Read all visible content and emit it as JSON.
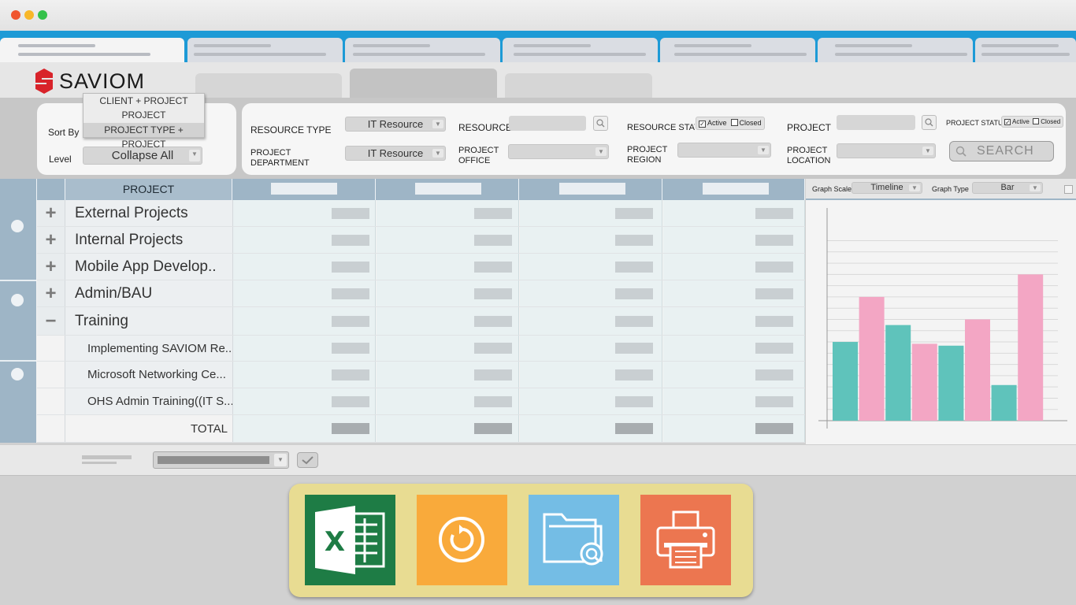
{
  "window": {
    "controls": {
      "close_color": "#f0552f",
      "minimize_color": "#f8b729",
      "maximize_color": "#35c14a"
    }
  },
  "app": {
    "logo_text": "SAVIOM",
    "logo_color": "#d8232a"
  },
  "sort": {
    "label": "Sort By",
    "options": [
      "CLIENT + PROJECT",
      "PROJECT",
      "PROJECT TYPE + PROJECT"
    ],
    "highlighted": "PROJECT TYPE + PROJECT"
  },
  "level": {
    "label": "Level",
    "value": "Collapse All"
  },
  "filters": {
    "resource_type": {
      "label": "RESOURCE TYPE",
      "value": "IT Resource"
    },
    "project_department": {
      "label_line1": "PROJECT",
      "label_line2": "DEPARTMENT",
      "value": "IT Resource"
    },
    "resource": {
      "label": "RESOURCE"
    },
    "project_office": {
      "label_line1": "PROJECT",
      "label_line2": "OFFICE"
    },
    "resource_status": {
      "label": "RESOURCE STATUS",
      "active": "Active",
      "closed": "Closed",
      "active_checked": true,
      "closed_checked": false
    },
    "project_region": {
      "label_line1": "PROJECT",
      "label_line2": "REGION"
    },
    "project": {
      "label": "PROJECT"
    },
    "project_location": {
      "label_line1": "PROJECT",
      "label_line2": "LOCATION"
    },
    "project_status": {
      "label": "PROJECT STATUS",
      "active": "Active",
      "closed": "Closed",
      "active_checked": true,
      "closed_checked": false
    },
    "search_button": "SEARCH"
  },
  "grid": {
    "header": "PROJECT",
    "rows": [
      {
        "name": "External Projects",
        "toggle": "+",
        "kind": "group"
      },
      {
        "name": "Internal Projects",
        "toggle": "+",
        "kind": "group"
      },
      {
        "name": "Mobile App Develop..",
        "toggle": "+",
        "kind": "group"
      },
      {
        "name": "Admin/BAU",
        "toggle": "+",
        "kind": "group"
      },
      {
        "name": "Training",
        "toggle": "−",
        "kind": "group"
      },
      {
        "name": "Implementing SAVIOM Re...",
        "kind": "child"
      },
      {
        "name": "Microsoft Networking  Ce...",
        "kind": "child"
      },
      {
        "name": "OHS Admin Training((IT S....",
        "kind": "child"
      }
    ],
    "total_label": "TOTAL"
  },
  "graph": {
    "scale_label": "Graph Scale",
    "scale_value": "Timeline",
    "type_label": "Graph Type",
    "type_value": "Bar"
  },
  "chart_data": {
    "type": "bar",
    "colors": {
      "teal": "#5fc3bb",
      "pink": "#f3a6c4"
    },
    "ylim": [
      0,
      10
    ],
    "grid": true,
    "series": [
      {
        "values": [
          4.2,
          5.1,
          4.0,
          1.9
        ],
        "color": "teal"
      },
      {
        "values": [
          6.6,
          4.1,
          5.4,
          7.8
        ],
        "color": "pink"
      }
    ],
    "order": [
      "teal",
      "pink",
      "teal",
      "pink",
      "teal",
      "pink",
      "teal",
      "pink"
    ]
  },
  "export": {
    "icons": [
      {
        "name": "excel-icon",
        "color": "#1e7c45"
      },
      {
        "name": "refresh-icon",
        "color": "#f9aa3b"
      },
      {
        "name": "folder-search-icon",
        "color": "#74bde5"
      },
      {
        "name": "printer-icon",
        "color": "#ec7650"
      }
    ]
  }
}
